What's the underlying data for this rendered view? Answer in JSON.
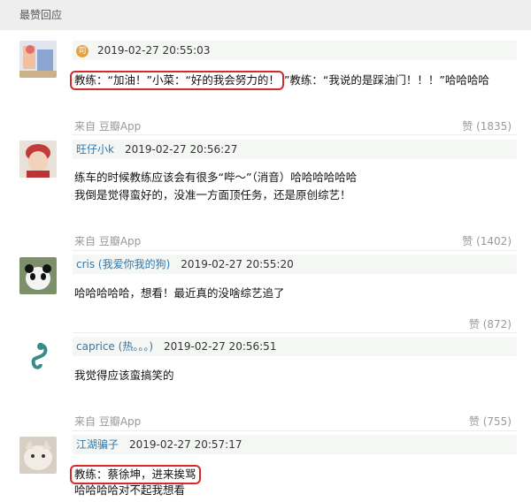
{
  "section": {
    "title": "最赞回应"
  },
  "comments": [
    {
      "user": "",
      "time": "2019-02-27 20:55:03",
      "line1_boxed": "教练：“加油！”小菜：“好的我会努力的！",
      "line1_rest": "”教练：“我说的是踩油门！！！”哈哈哈哈",
      "source": "来自 豆瓣App",
      "likes": "赞 (1835)"
    },
    {
      "user": "旺仔小k",
      "time": "2019-02-27 20:56:27",
      "line1": "练车的时候教练应该会有很多“哔～”（消音）哈哈哈哈哈哈",
      "line2": "我倒是觉得蛮好的，没准一方面顶任务，还是原创综艺！",
      "source": "来自 豆瓣App",
      "likes": "赞 (1402)"
    },
    {
      "user": "cris (我爱你我的狗)",
      "time": "2019-02-27 20:55:20",
      "line1": "哈哈哈哈哈，想看！最近真的没啥综艺追了",
      "likes": "赞 (872)"
    },
    {
      "user": "caprice (热。。。)",
      "time": "2019-02-27 20:56:51",
      "line1": "我觉得应该蛮搞笑的",
      "source": "来自 豆瓣App",
      "likes": "赞 (755)"
    },
    {
      "user": "江湖骗子",
      "time": "2019-02-27 20:57:17",
      "line1_boxed": "教练：蔡徐坤，进来挨骂",
      "line2": "哈哈哈哈对不起我想看"
    }
  ],
  "colors": {
    "highlight_box": "#d42a2a",
    "username": "#3377aa",
    "meta_bg": "#f5f7f5"
  },
  "icons": {
    "badge": "user-badge-icon"
  }
}
